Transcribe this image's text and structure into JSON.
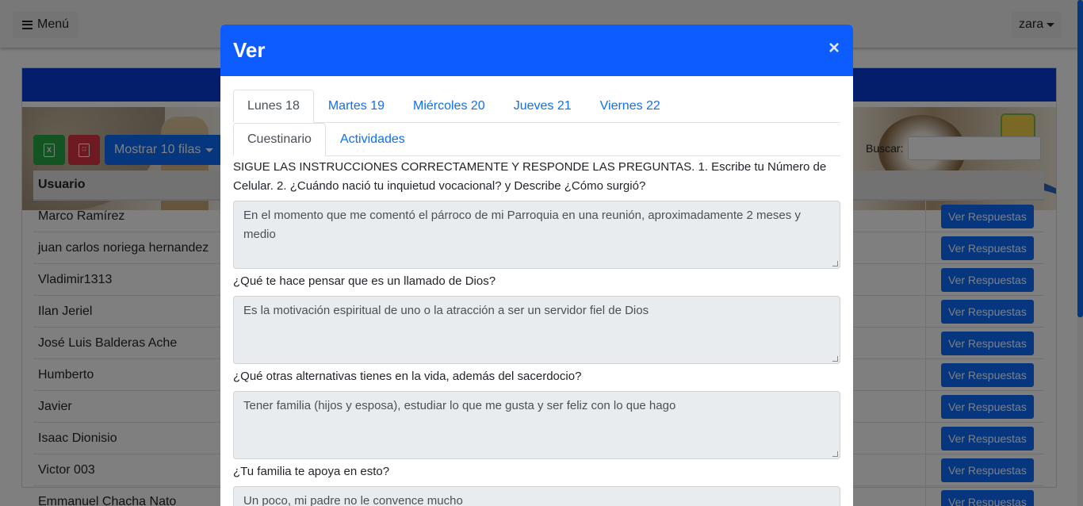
{
  "navbar": {
    "menu_label": "Menú",
    "user_label": "zara"
  },
  "toolbar": {
    "excel_label": "X",
    "pdf_label": "PDF",
    "show_rows_label": "Mostrar 10 filas",
    "search_label": "Buscar:"
  },
  "table": {
    "header": "Usuario",
    "action_label": "Ver Respuestas",
    "rows": [
      "Marco Ramírez",
      "juan carlos noriega hernandez",
      "Vladimir1313",
      "Ilan Jeriel",
      "José Luis Balderas Ache",
      "Humberto",
      "Javier",
      "Isaac Dionisio",
      "Victor 003",
      "Emmanuel Chacha Nato"
    ]
  },
  "modal": {
    "title": "Ver",
    "close": "×",
    "day_tabs": [
      "Lunes 18",
      "Martes 19",
      "Miércoles 20",
      "Jueves 21",
      "Viernes 22"
    ],
    "section_tabs": [
      "Cuestinario",
      "Actividades"
    ],
    "questions": [
      {
        "q": "SIGUE LAS INSTRUCCIONES CORRECTAMENTE Y RESPONDE LAS PREGUNTAS. 1. Escribe tu Número de Celular. 2. ¿Cuándo nació tu inquietud vocacional? y Describe ¿Cómo surgió?",
        "a": "En el momento que me comentó el párroco de mi Parroquia en una reunión, aproximadamente 2 meses y medio"
      },
      {
        "q": "¿Qué te hace pensar que es un llamado de Dios?",
        "a": "Es la motivación espiritual de uno o la atracción a ser un servidor fiel de Dios"
      },
      {
        "q": "¿Qué otras alternativas tienes en la vida, además del sacerdocio?",
        "a": "Tener familia (hijos y esposa), estudiar lo que me gusta y ser feliz con lo que hago"
      },
      {
        "q": "¿Tu familia te apoya en esto?",
        "a": "Un poco, mi padre no le convence mucho"
      }
    ]
  }
}
